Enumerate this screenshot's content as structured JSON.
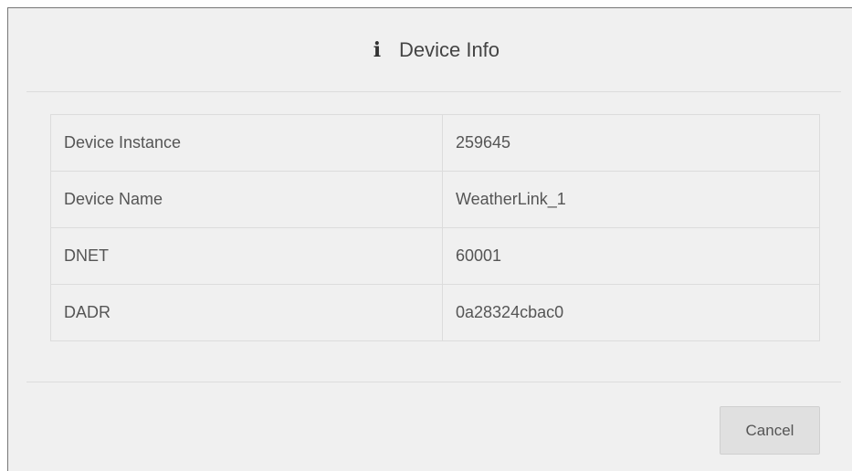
{
  "dialog": {
    "title": "Device Info",
    "icon": "info-icon",
    "icon_glyph": "i"
  },
  "table": {
    "rows": [
      {
        "label": "Device Instance",
        "value": "259645"
      },
      {
        "label": "Device Name",
        "value": "WeatherLink_1"
      },
      {
        "label": "DNET",
        "value": "60001"
      },
      {
        "label": "DADR",
        "value": "0a28324cbac0"
      }
    ]
  },
  "footer": {
    "cancel_label": "Cancel"
  }
}
